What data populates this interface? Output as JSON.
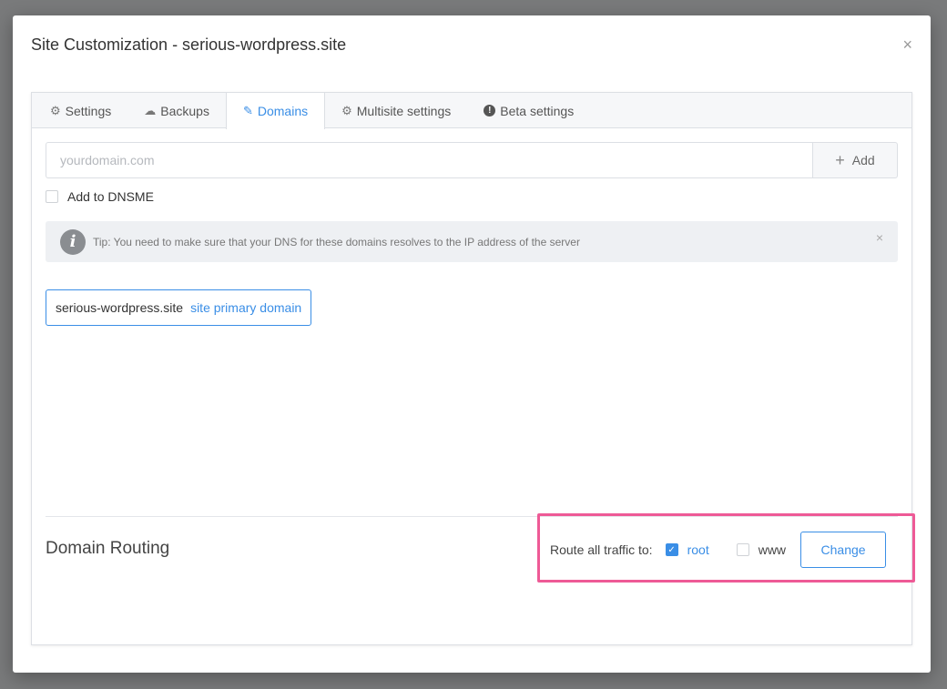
{
  "modal": {
    "title": "Site Customization - serious-wordpress.site",
    "close_icon": "×"
  },
  "tabs": [
    {
      "label": "Settings",
      "icon": "gear-icon",
      "active": false
    },
    {
      "label": "Backups",
      "icon": "cloud-upload-icon",
      "active": false
    },
    {
      "label": "Domains",
      "icon": "edit-icon",
      "active": true
    },
    {
      "label": "Multisite settings",
      "icon": "gear-icon",
      "active": false
    },
    {
      "label": "Beta settings",
      "icon": "alert-circle-icon",
      "active": false
    }
  ],
  "domain_input": {
    "placeholder": "yourdomain.com",
    "value": ""
  },
  "add_button": {
    "label": "Add",
    "icon": "plus-icon"
  },
  "dnsme": {
    "label": "Add to DNSME",
    "checked": false
  },
  "tip": {
    "icon": "info-icon",
    "text": "Tip: You need to make sure that your DNS for these domains resolves to the IP address of the server"
  },
  "domains": [
    {
      "name": "serious-wordpress.site",
      "label": "site primary domain"
    }
  ],
  "routing": {
    "title": "Domain Routing",
    "route_label": "Route all traffic to:",
    "options": [
      {
        "label": "root",
        "checked": true
      },
      {
        "label": "www",
        "checked": false
      }
    ],
    "change_label": "Change"
  },
  "colors": {
    "accent": "#3a8ee6",
    "highlight": "#ee5a96"
  }
}
